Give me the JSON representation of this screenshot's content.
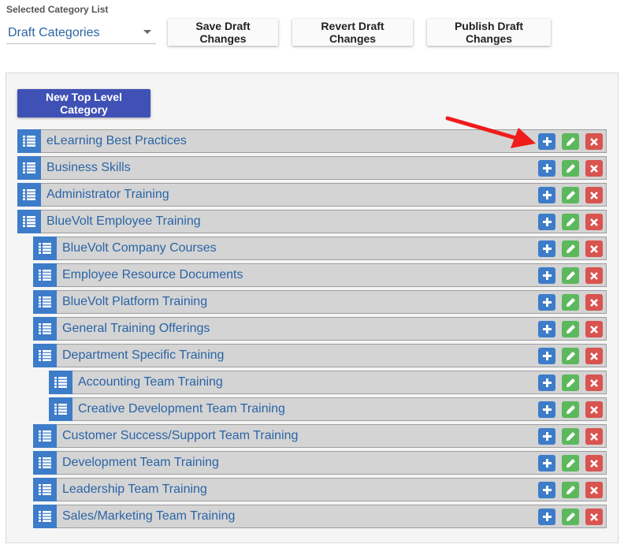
{
  "header": {
    "list_label": "Selected Category List",
    "selected_list": "Draft Categories",
    "save_label": "Save Draft Changes",
    "revert_label": "Revert Draft Changes",
    "publish_label": "Publish Draft Changes"
  },
  "panel": {
    "new_top_label": "New Top Level Category"
  },
  "colors": {
    "handle": "#3d7cc9",
    "add": "#3d7cc9",
    "edit": "#5cb85c",
    "delete": "#d9534f",
    "label": "#2a64a6",
    "new_button": "#3f51b5",
    "arrow": "#ee1c1c"
  },
  "categories": [
    {
      "label": "eLearning Best Practices",
      "depth": 0
    },
    {
      "label": "Business Skills",
      "depth": 0
    },
    {
      "label": "Administrator Training",
      "depth": 0
    },
    {
      "label": "BlueVolt Employee Training",
      "depth": 0
    },
    {
      "label": "BlueVolt Company Courses",
      "depth": 1
    },
    {
      "label": "Employee Resource Documents",
      "depth": 1
    },
    {
      "label": "BlueVolt Platform Training",
      "depth": 1
    },
    {
      "label": "General Training Offerings",
      "depth": 1
    },
    {
      "label": "Department Specific Training",
      "depth": 1
    },
    {
      "label": "Accounting Team Training",
      "depth": 2
    },
    {
      "label": "Creative Development Team Training",
      "depth": 2
    },
    {
      "label": "Customer Success/Support Team Training",
      "depth": 1
    },
    {
      "label": "Development Team Training",
      "depth": 1
    },
    {
      "label": "Leadership Team Training",
      "depth": 1
    },
    {
      "label": "Sales/Marketing Team Training",
      "depth": 1
    }
  ],
  "icons": {
    "handle": "list-icon",
    "add": "plus-icon",
    "edit": "pencil-icon",
    "delete": "close-icon",
    "annotation": "red-arrow-icon"
  }
}
